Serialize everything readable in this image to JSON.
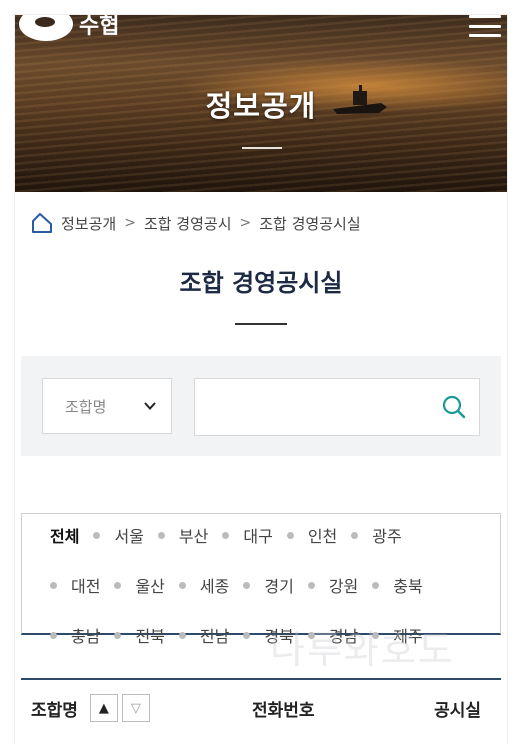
{
  "header": {
    "logo_text": "수협",
    "hero_title": "정보공개"
  },
  "breadcrumb": {
    "items": [
      "정보공개",
      "조합 경영공시",
      "조합 경영공시실"
    ],
    "separator": ">"
  },
  "page_title": "조합 경영공시실",
  "search": {
    "select_value": "조합명",
    "input_value": ""
  },
  "regions": [
    "전체",
    "서울",
    "부산",
    "대구",
    "인천",
    "광주",
    "대전",
    "울산",
    "세종",
    "경기",
    "강원",
    "충북",
    "충남",
    "전북",
    "전남",
    "경북",
    "경남",
    "제주"
  ],
  "active_region": "전체",
  "watermark": "나루와호도",
  "table": {
    "col_name": "조합명",
    "sort_up": "▲",
    "sort_down": "▽",
    "col_phone": "전화번호",
    "col_disclosure": "공시실"
  }
}
